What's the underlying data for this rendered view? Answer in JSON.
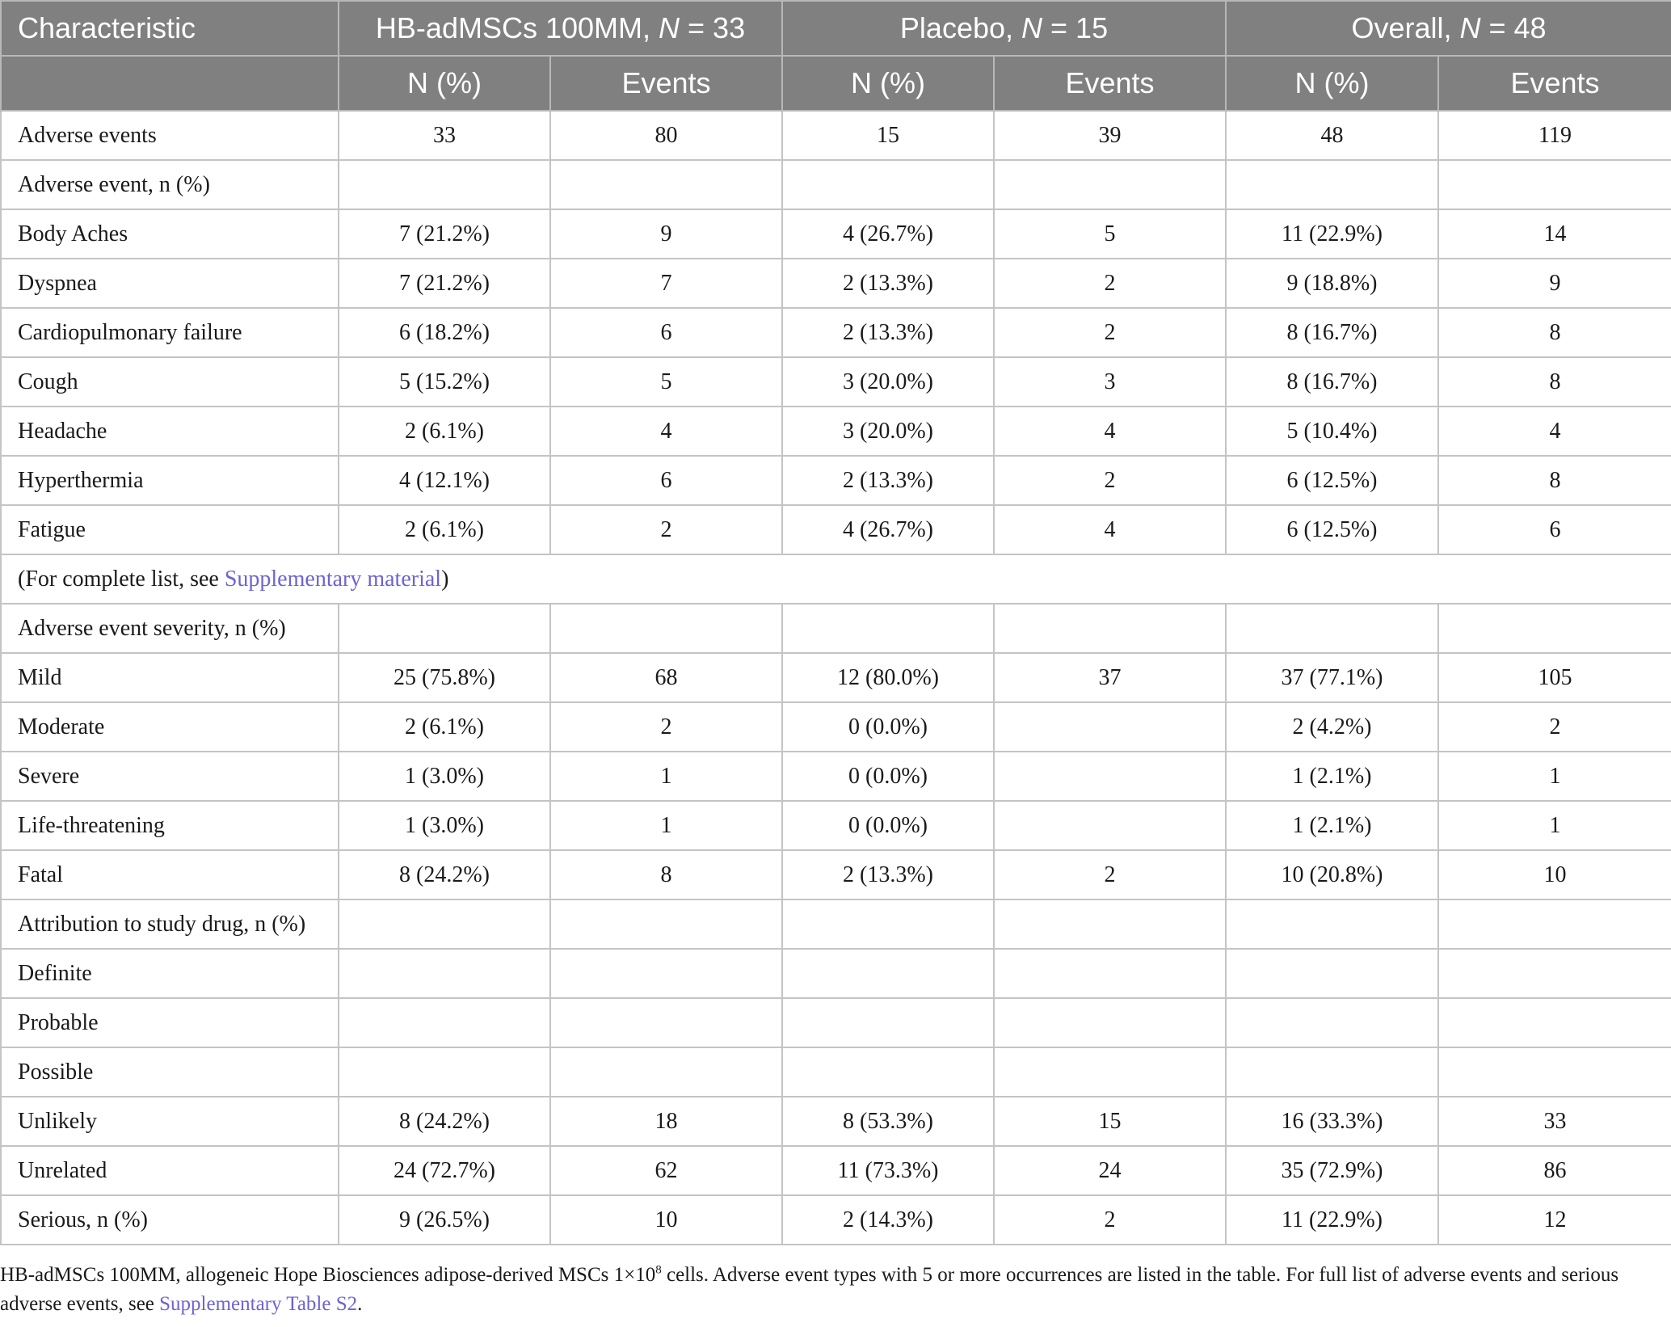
{
  "header": {
    "characteristic": "Characteristic",
    "groups": [
      {
        "name": "HB-adMSCs 100MM, ",
        "n_label": "N",
        "n_eq": " = 33"
      },
      {
        "name": "Placebo, ",
        "n_label": "N",
        "n_eq": " = 15"
      },
      {
        "name": "Overall, ",
        "n_label": "N",
        "n_eq": " = 48"
      }
    ],
    "sub": [
      "N (%)",
      "Events",
      "N (%)",
      "Events",
      "N (%)",
      "Events"
    ]
  },
  "rows": [
    {
      "label": "Adverse events",
      "cells": [
        "33",
        "80",
        "15",
        "39",
        "48",
        "119"
      ]
    },
    {
      "label": "Adverse event, n (%)",
      "cells": [
        "",
        "",
        "",
        "",
        "",
        ""
      ]
    },
    {
      "label": "Body Aches",
      "cells": [
        "7 (21.2%)",
        "9",
        "4 (26.7%)",
        "5",
        "11 (22.9%)",
        "14"
      ]
    },
    {
      "label": "Dyspnea",
      "cells": [
        "7 (21.2%)",
        "7",
        "2 (13.3%)",
        "2",
        "9 (18.8%)",
        "9"
      ]
    },
    {
      "label": "Cardiopulmonary failure",
      "cells": [
        "6 (18.2%)",
        "6",
        "2 (13.3%)",
        "2",
        "8 (16.7%)",
        "8"
      ]
    },
    {
      "label": "Cough",
      "cells": [
        "5 (15.2%)",
        "5",
        "3 (20.0%)",
        "3",
        "8 (16.7%)",
        "8"
      ]
    },
    {
      "label": "Headache",
      "cells": [
        "2 (6.1%)",
        "4",
        "3 (20.0%)",
        "4",
        "5 (10.4%)",
        "4"
      ]
    },
    {
      "label": "Hyperthermia",
      "cells": [
        "4 (12.1%)",
        "6",
        "2 (13.3%)",
        "2",
        "6 (12.5%)",
        "8"
      ]
    },
    {
      "label": "Fatigue",
      "cells": [
        "2 (6.1%)",
        "2",
        "4 (26.7%)",
        "4",
        "6 (12.5%)",
        "6"
      ]
    },
    {
      "span": true,
      "pre": "(For complete list, see ",
      "link": "Supplementary material",
      "post": ")"
    },
    {
      "label": "Adverse event severity, n (%)",
      "cells": [
        "",
        "",
        "",
        "",
        "",
        ""
      ]
    },
    {
      "label": "Mild",
      "cells": [
        "25 (75.8%)",
        "68",
        "12 (80.0%)",
        "37",
        "37 (77.1%)",
        "105"
      ]
    },
    {
      "label": "Moderate",
      "cells": [
        "2 (6.1%)",
        "2",
        "0 (0.0%)",
        "",
        "2 (4.2%)",
        "2"
      ]
    },
    {
      "label": "Severe",
      "cells": [
        "1 (3.0%)",
        "1",
        "0 (0.0%)",
        "",
        "1 (2.1%)",
        "1"
      ]
    },
    {
      "label": "Life-threatening",
      "cells": [
        "1 (3.0%)",
        "1",
        "0 (0.0%)",
        "",
        "1 (2.1%)",
        "1"
      ]
    },
    {
      "label": "Fatal",
      "cells": [
        "8 (24.2%)",
        "8",
        "2 (13.3%)",
        "2",
        "10 (20.8%)",
        "10"
      ]
    },
    {
      "label": "Attribution to study drug, n (%)",
      "cells": [
        "",
        "",
        "",
        "",
        "",
        ""
      ]
    },
    {
      "label": "Definite",
      "cells": [
        "",
        "",
        "",
        "",
        "",
        ""
      ]
    },
    {
      "label": "Probable",
      "cells": [
        "",
        "",
        "",
        "",
        "",
        ""
      ]
    },
    {
      "label": "Possible",
      "cells": [
        "",
        "",
        "",
        "",
        "",
        ""
      ]
    },
    {
      "label": "Unlikely",
      "cells": [
        "8 (24.2%)",
        "18",
        "8 (53.3%)",
        "15",
        "16 (33.3%)",
        "33"
      ]
    },
    {
      "label": "Unrelated",
      "cells": [
        "24 (72.7%)",
        "62",
        "11 (73.3%)",
        "24",
        "35 (72.9%)",
        "86"
      ]
    },
    {
      "label": "Serious, n (%)",
      "cells": [
        "9 (26.5%)",
        "10",
        "2 (14.3%)",
        "2",
        "11 (22.9%)",
        "12"
      ]
    }
  ],
  "footnote": {
    "text1": "HB-adMSCs 100MM, allogeneic Hope Biosciences adipose-derived MSCs 1×10",
    "sup": "8",
    "text2": " cells. Adverse event types with 5 or more occurrences are listed in the table. For full list of adverse events and serious adverse events, see ",
    "link": "Supplementary Table S2",
    "end": "."
  }
}
